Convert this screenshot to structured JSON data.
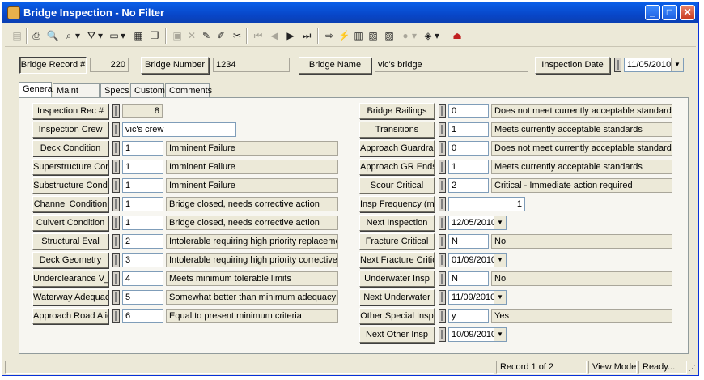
{
  "window": {
    "title": "Bridge Inspection - No Filter"
  },
  "header": {
    "bridge_record_label": "Bridge Record #",
    "bridge_record_value": "220",
    "bridge_number_label": "Bridge Number",
    "bridge_number_value": "1234",
    "bridge_name_label": "Bridge Name",
    "bridge_name_value": "vic's bridge",
    "inspection_date_label": "Inspection Date",
    "inspection_date_value": "11/05/2010"
  },
  "tabs": [
    {
      "label": "General",
      "active": true
    },
    {
      "label": "Maint Cond"
    },
    {
      "label": "Specs"
    },
    {
      "label": "Custom"
    },
    {
      "label": "Comments"
    }
  ],
  "left": {
    "inspection_rec": {
      "label": "Inspection Rec #",
      "value": "8"
    },
    "inspection_crew": {
      "label": "Inspection Crew",
      "value": "vic's crew"
    },
    "rows": [
      {
        "label": "Deck Condition",
        "value": "1",
        "desc": "Imminent Failure"
      },
      {
        "label": "Superstructure Cond",
        "value": "1",
        "desc": "Imminent Failure"
      },
      {
        "label": "Substructure Cond",
        "value": "1",
        "desc": "Imminent Failure"
      },
      {
        "label": "Channel Condition",
        "value": "1",
        "desc": "Bridge closed, needs corrective action"
      },
      {
        "label": "Culvert Condition",
        "value": "1",
        "desc": "Bridge closed, needs corrective action"
      },
      {
        "label": "Structural Eval",
        "value": "2",
        "desc": "Intolerable requiring high priority replacement"
      },
      {
        "label": "Deck Geometry",
        "value": "3",
        "desc": "Intolerable requiring high priority corrective action"
      },
      {
        "label": "Underclearance V_H",
        "value": "4",
        "desc": "Meets minimum tolerable limits"
      },
      {
        "label": "Waterway Adequacy",
        "value": "5",
        "desc": "Somewhat better than minimum adequacy"
      },
      {
        "label": "Approach Road Align",
        "value": "6",
        "desc": "Equal to present minimum criteria"
      }
    ]
  },
  "right": {
    "rows": [
      {
        "label": "Bridge Railings",
        "value": "0",
        "desc": "Does not meet currently acceptable standards"
      },
      {
        "label": "Transitions",
        "value": "1",
        "desc": "Meets currently acceptable standards"
      },
      {
        "label": "Approach Guardrail",
        "value": "0",
        "desc": "Does not meet currently acceptable standards"
      },
      {
        "label": "Approach GR Ends",
        "value": "1",
        "desc": "Meets currently acceptable standards"
      },
      {
        "label": "Scour Critical",
        "value": "2",
        "desc": "Critical - Immediate action required"
      }
    ],
    "insp_frequency": {
      "label": "Insp Frequency (m)",
      "value": "1"
    },
    "next_inspection": {
      "label": "Next Inspection",
      "value": "12/05/2010"
    },
    "fracture_critical": {
      "label": "Fracture Critical",
      "value": "N",
      "desc": "No"
    },
    "next_fracture_critical": {
      "label": "Next Fracture Critical",
      "value": "01/09/2010"
    },
    "underwater_insp": {
      "label": "Underwater Insp",
      "value": "N",
      "desc": "No"
    },
    "next_underwater": {
      "label": "Next Underwater",
      "value": "11/09/2010"
    },
    "other_special_insp": {
      "label": "Other Special Insp",
      "value": "y",
      "desc": "Yes"
    },
    "next_other_insp": {
      "label": "Next Other Insp",
      "value": "10/09/2010"
    }
  },
  "status": {
    "record": "Record 1 of 2",
    "mode": "View Mode",
    "state": "Ready..."
  },
  "colors": {
    "title_bar": "#0846C8",
    "face": "#ECE9D8",
    "field_border": "#7F9DB9"
  }
}
